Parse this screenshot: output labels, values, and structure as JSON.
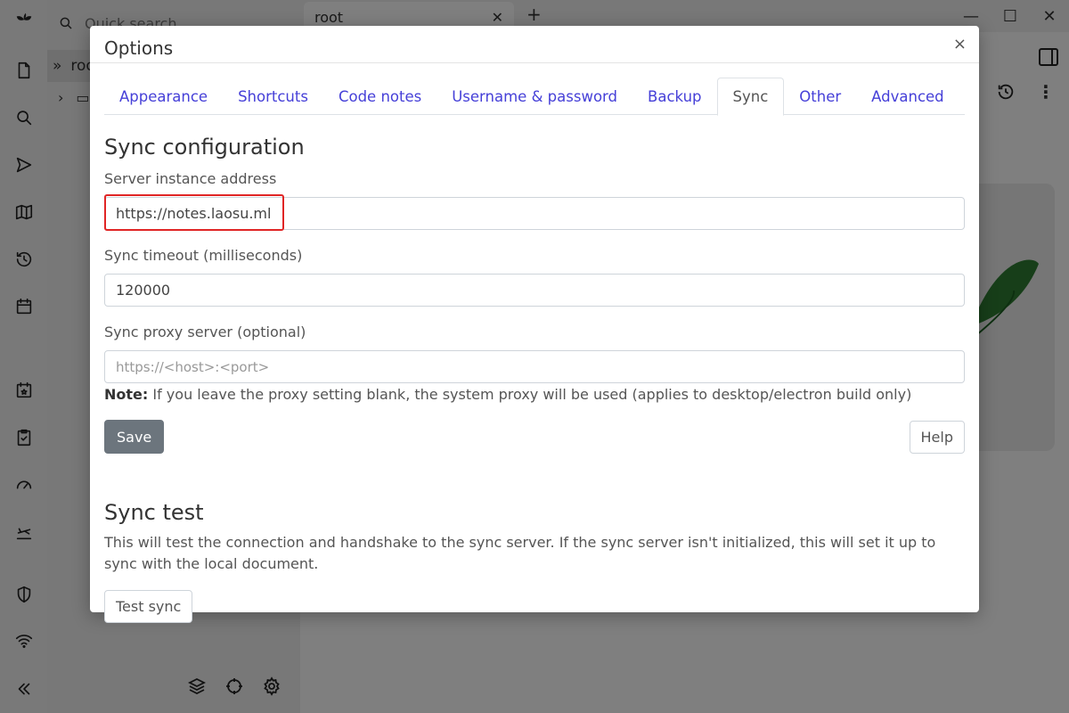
{
  "background": {
    "quick_search_placeholder": "Quick search",
    "tree_root_label": "root",
    "tab_title": "root",
    "new_tab": "+",
    "window_controls": {
      "minimize": "—",
      "maximize": "☐",
      "close": "✕"
    }
  },
  "modal": {
    "title": "Options",
    "close_label": "×",
    "tabs": [
      {
        "label": "Appearance",
        "active": false
      },
      {
        "label": "Shortcuts",
        "active": false
      },
      {
        "label": "Code notes",
        "active": false
      },
      {
        "label": "Username & password",
        "active": false
      },
      {
        "label": "Backup",
        "active": false
      },
      {
        "label": "Sync",
        "active": true
      },
      {
        "label": "Other",
        "active": false
      },
      {
        "label": "Advanced",
        "active": false
      }
    ],
    "sync_config": {
      "heading": "Sync configuration",
      "server_label": "Server instance address",
      "server_value": "https://notes.laosu.ml",
      "timeout_label": "Sync timeout (milliseconds)",
      "timeout_value": "120000",
      "proxy_label": "Sync proxy server (optional)",
      "proxy_value": "",
      "proxy_placeholder": "https://<host>:<port>",
      "note_prefix": "Note:",
      "note_text": " If you leave the proxy setting blank, the system proxy will be used (applies to desktop/electron build only)",
      "save_label": "Save",
      "help_label": "Help"
    },
    "sync_test": {
      "heading": "Sync test",
      "description": "This will test the connection and handshake to the sync server. If the sync server isn't initialized, this will set it up to sync with the local document.",
      "button_label": "Test sync"
    }
  },
  "colors": {
    "link_tab": "#4640d8",
    "save_button": "#6c757d",
    "highlight_box": "#e02525",
    "overlay": "rgba(0,0,0,0.5)"
  }
}
